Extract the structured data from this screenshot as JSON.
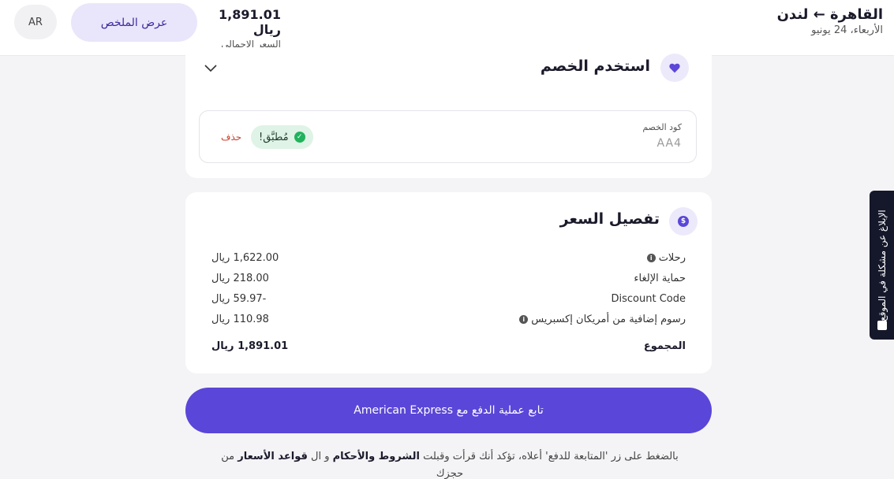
{
  "header": {
    "route_title": "القاهرة ← لندن",
    "route_date": "الأربعاء، 24 يونيو",
    "total_price": "1,891.01 ريال",
    "total_label": "السعر الإجمالي",
    "summary_button": "عرض الملخص",
    "language_button": "AR"
  },
  "discount": {
    "title": "استخدم الخصم",
    "code_label": "كود الخصم",
    "code_value": "AA4",
    "applied_badge": "مُطبَّق!",
    "delete_link": "حذف"
  },
  "price_breakdown": {
    "title": "تفصيل السعر",
    "rows": [
      {
        "label": "رحلات",
        "value": "1,622.00 ريال",
        "info": true
      },
      {
        "label": "حماية الإلغاء",
        "value": "218.00 ريال",
        "info": false
      },
      {
        "label": "Discount Code",
        "value": "-59.97 ريال",
        "info": false
      },
      {
        "label": "رسوم إضافية من أمريكان إكسبريس",
        "value": "110.98 ريال",
        "info": true
      }
    ],
    "total_label": "المجموع",
    "total_value": "1,891.01 ريال"
  },
  "pay_button": "تابع عملية الدفع مع American Express",
  "terms": {
    "prefix": "بالضغط على زر 'المتابعة للدفع' أعلاه، تؤكد أنك قرأت وقبلت",
    "terms_link": "الشروط والأحكام",
    "and": "و ال",
    "rules_link": "قواعد الأسعار",
    "suffix": "من حجزك"
  },
  "report_tab": "الإبلاغ عن مشكلة في الموقع",
  "colors": {
    "accent": "#5a46d8",
    "success": "#22b25d",
    "danger": "#c8402f"
  }
}
